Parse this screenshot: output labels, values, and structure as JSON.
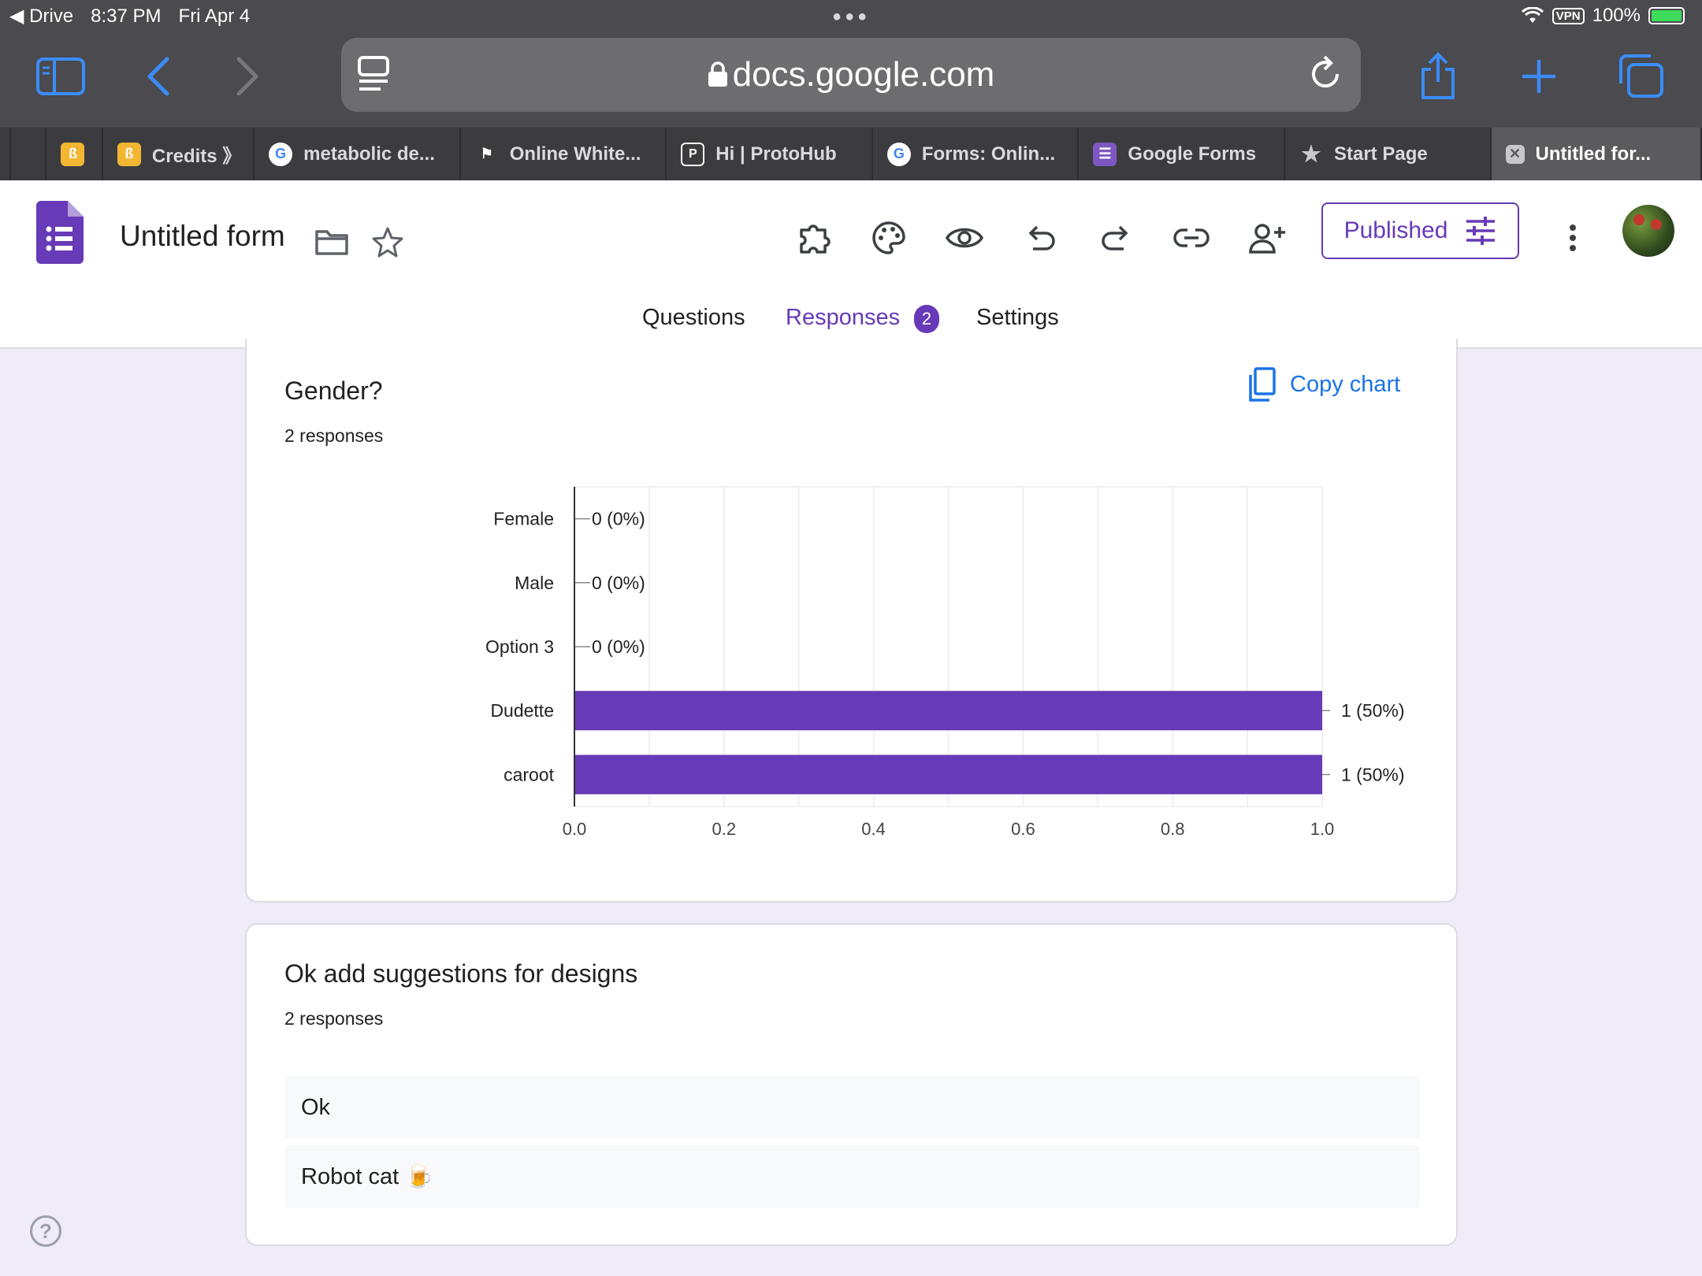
{
  "status_bar": {
    "back_app": "Drive",
    "time": "8:37 PM",
    "date": "Fri Apr 4",
    "vpn": "VPN",
    "battery": "100%"
  },
  "browser": {
    "url": "docs.google.com",
    "tabs": [
      {
        "label": "",
        "icon": "bookmark-app-icon"
      },
      {
        "label": "Credits 》",
        "icon": "bookmark-app-icon"
      },
      {
        "label": "metabolic de...",
        "icon": "google-icon"
      },
      {
        "label": "Online White...",
        "icon": "flag-icon"
      },
      {
        "label": "Hi | ProtoHub",
        "icon": "protohub-icon"
      },
      {
        "label": "Forms: Onlin...",
        "icon": "google-icon"
      },
      {
        "label": "Google Forms",
        "icon": "forms-icon"
      },
      {
        "label": "Start Page",
        "icon": "star-icon"
      },
      {
        "label": "Untitled for...",
        "icon": "close-icon"
      }
    ]
  },
  "form": {
    "title": "Untitled form",
    "published_label": "Published",
    "nav": {
      "questions": "Questions",
      "responses": "Responses",
      "responses_count": "2",
      "settings": "Settings"
    }
  },
  "question1": {
    "title": "Gender?",
    "count": "2 responses",
    "copy_label": "Copy chart"
  },
  "chart_data": {
    "type": "bar",
    "orientation": "horizontal",
    "categories": [
      "Female",
      "Male",
      "Option 3",
      "Dudette",
      "caroot"
    ],
    "values": [
      0,
      0,
      0,
      1,
      1
    ],
    "data_labels": [
      "0 (0%)",
      "0 (0%)",
      "0 (0%)",
      "1 (50%)",
      "1 (50%)"
    ],
    "x_ticks": [
      "0.0",
      "0.2",
      "0.4",
      "0.6",
      "0.8",
      "1.0"
    ],
    "xlim": [
      0,
      1
    ],
    "grid": true,
    "bar_color": "#673ab7"
  },
  "question2": {
    "title": "Ok add suggestions for designs",
    "count": "2 responses",
    "answers": [
      "Ok",
      "Robot cat 🍺"
    ]
  },
  "help_label": "?"
}
